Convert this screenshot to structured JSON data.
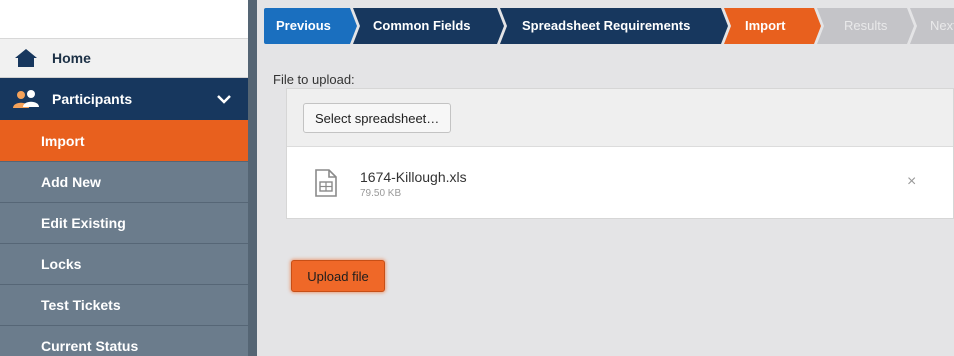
{
  "sidebar": {
    "home_label": "Home",
    "participants_label": "Participants",
    "items": [
      {
        "label": "Import",
        "active": true
      },
      {
        "label": "Add New",
        "active": false
      },
      {
        "label": "Edit Existing",
        "active": false
      },
      {
        "label": "Locks",
        "active": false
      },
      {
        "label": "Test Tickets",
        "active": false
      },
      {
        "label": "Current Status",
        "active": false
      }
    ]
  },
  "wizard": {
    "steps": [
      {
        "label": "Previous",
        "state": "nav"
      },
      {
        "label": "Common Fields",
        "state": "done"
      },
      {
        "label": "Spreadsheet Requirements",
        "state": "done"
      },
      {
        "label": "Import",
        "state": "current"
      },
      {
        "label": "Results",
        "state": "pending"
      },
      {
        "label": "Next",
        "state": "pending"
      }
    ]
  },
  "upload": {
    "file_label": "File to upload:",
    "select_button": "Select spreadsheet…",
    "file_name": "1674-Killough.xls",
    "file_size": "79.50 KB",
    "remove_symbol": "×",
    "upload_button": "Upload file"
  },
  "colors": {
    "navy": "#17375e",
    "orange": "#e8601e",
    "blue": "#1a6fbf",
    "gray_step": "#c4c4c8",
    "sidebar_sub": "#6b7c8c"
  }
}
